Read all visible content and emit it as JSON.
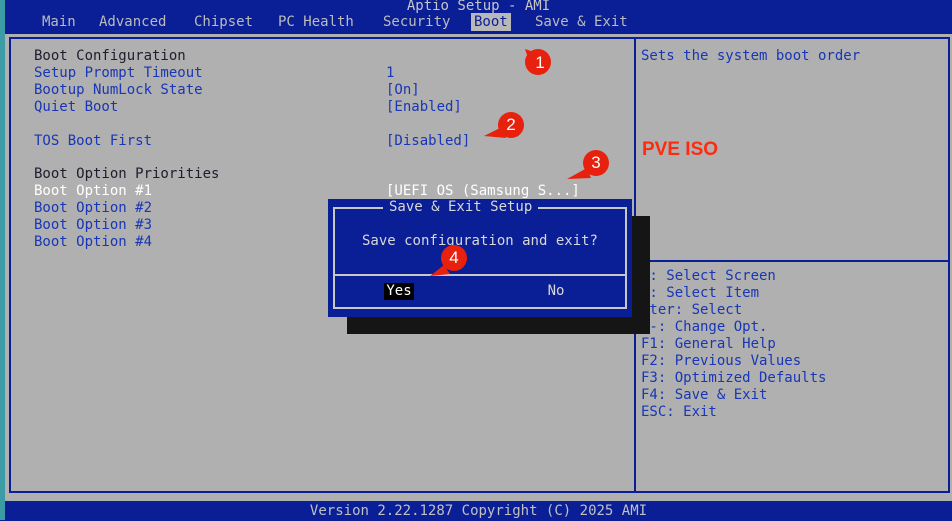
{
  "app": {
    "title": "Aptio Setup - AMI"
  },
  "menu": [
    "Main",
    "Advanced",
    "Chipset",
    "PC Health",
    "Security",
    "Boot",
    "Save & Exit"
  ],
  "menu_active": "Boot",
  "boot": {
    "config_header": "Boot Configuration",
    "setup_prompt_label": "Setup Prompt Timeout",
    "setup_prompt_value": "1",
    "numlock_label": "Bootup NumLock State",
    "numlock_value": "[On]",
    "quiet_label": "Quiet Boot",
    "quiet_value": "[Enabled]",
    "tos_label": "TOS Boot First",
    "tos_value": "[Disabled]",
    "priorities_header": "Boot Option Priorities",
    "opt1_label": "Boot Option #1",
    "opt1_value": "[UEFI OS (Samsung S...]",
    "opt2_label": "Boot Option #2",
    "opt3_label": "Boot Option #3",
    "opt4_label": "Boot Option #4"
  },
  "help": {
    "description": "Sets the system boot order",
    "keys": [
      "←: Select Screen",
      "↓: Select Item",
      "nter: Select",
      "/-: Change Opt.",
      "F1: General Help",
      "F2: Previous Values",
      "F3: Optimized Defaults",
      "F4: Save & Exit",
      "ESC: Exit"
    ]
  },
  "dialog": {
    "title": "Save & Exit Setup",
    "message": "Save configuration and exit?",
    "yes_label": "Yes",
    "no_label": "No"
  },
  "annotations": {
    "markers": [
      "1",
      "2",
      "3",
      "4"
    ],
    "pve_label": "PVE ISO",
    "marker_color": "#e8200e"
  },
  "footer": {
    "text": "Version 2.22.1287 Copyright (C) 2025 AMI"
  },
  "colors": {
    "background": "#0a1e96",
    "panel": "#b0b0b0",
    "selectable_text": "#1836b5"
  }
}
